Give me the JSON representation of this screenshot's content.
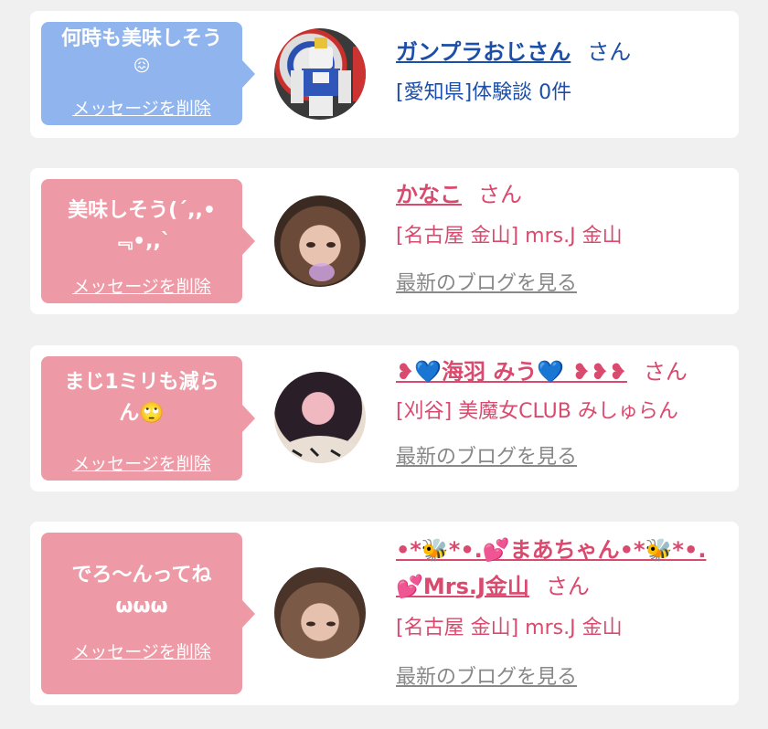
{
  "colors": {
    "blue_bubble": "#8fb4ee",
    "pink_bubble": "#ee9aa6",
    "blue_text": "#1c4fa8",
    "pink_text": "#d94a6e",
    "link_gray": "#888888"
  },
  "entries": [
    {
      "message": "何時も美味しそう",
      "message_emoji": "😖",
      "delete_label": "メッセージを削除",
      "name": "ガンプラおじさん",
      "honorific": "さん",
      "subtitle": "[愛知県]体験談 0件",
      "avatar_icon": "robot-figure-photo"
    },
    {
      "message": "美味しそう(´,,•\n﹃•,,`",
      "delete_label": "メッセージを削除",
      "name": "かなこ",
      "honorific": "さん",
      "subtitle": "[名古屋 金山] mrs.J 金山",
      "blog_link": "最新のブログを見る",
      "avatar_icon": "woman-photo"
    },
    {
      "message": "まじ1ミリも減ら\nん🙄",
      "delete_label": "メッセージを削除",
      "name": "❥💙海羽 みう💙 ❥❥❥",
      "honorific": "さん",
      "subtitle": "[刈谷] 美魔女CLUB みしゅらん",
      "blog_link": "最新のブログを見る",
      "avatar_icon": "woman-photo"
    },
    {
      "message": "でろ〜んってね\nωωω",
      "delete_label": "メッセージを削除",
      "name_line1": "•*🐝*•.💕まあちゃん•*🐝*•.",
      "name_line2": "💕Mrs.J金山",
      "honorific": "さん",
      "subtitle": "[名古屋 金山] mrs.J 金山",
      "blog_link": "最新のブログを見る",
      "avatar_icon": "woman-photo"
    }
  ]
}
